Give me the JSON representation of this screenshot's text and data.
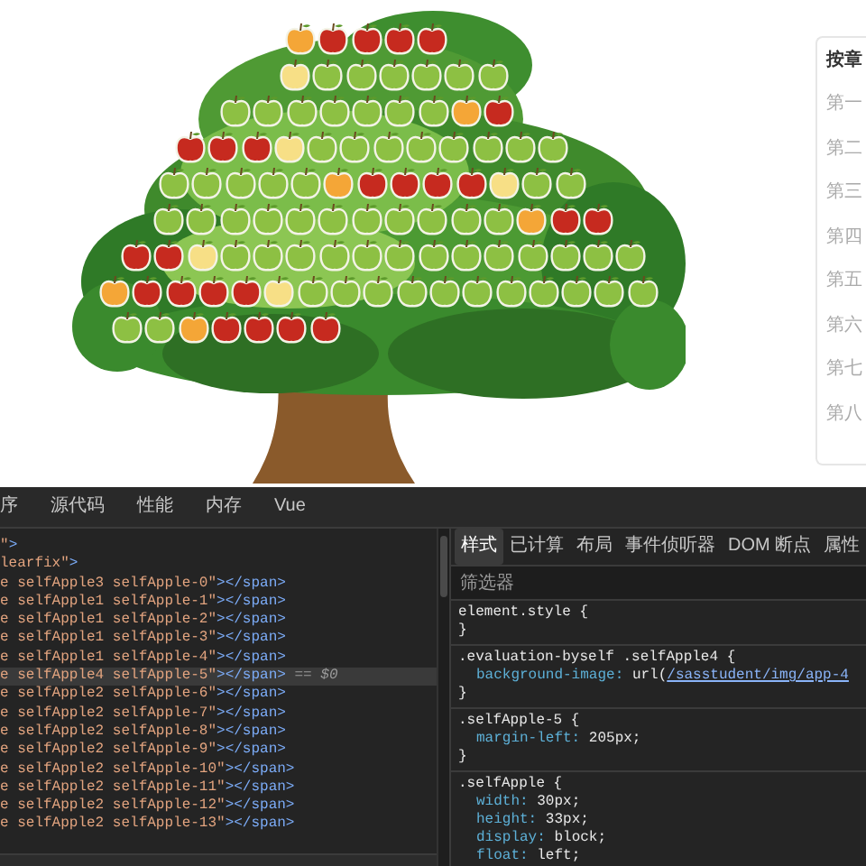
{
  "apple_tree": {
    "rows": [
      [
        {
          "color": "#f4a637"
        },
        {
          "color": "#c62a1f"
        },
        {
          "color": "#c62a1f"
        },
        {
          "color": "#c62a1f"
        },
        {
          "color": "#c62a1f"
        }
      ],
      [
        {
          "color": "#f7df86"
        },
        {
          "color": "#8dc043"
        },
        {
          "color": "#8dc043"
        },
        {
          "color": "#8dc043"
        },
        {
          "color": "#8dc043"
        },
        {
          "color": "#8dc043"
        },
        {
          "color": "#8dc043"
        }
      ],
      [
        {
          "color": "#8dc043"
        },
        {
          "color": "#8dc043"
        },
        {
          "color": "#8dc043"
        },
        {
          "color": "#8dc043"
        },
        {
          "color": "#8dc043"
        },
        {
          "color": "#8dc043"
        },
        {
          "color": "#8dc043"
        },
        {
          "color": "#f4a637"
        },
        {
          "color": "#c62a1f"
        }
      ],
      [
        {
          "color": "#c62a1f"
        },
        {
          "color": "#c62a1f"
        },
        {
          "color": "#c62a1f"
        },
        {
          "color": "#f7df86"
        },
        {
          "color": "#8dc043"
        },
        {
          "color": "#8dc043"
        },
        {
          "color": "#8dc043"
        },
        {
          "color": "#8dc043"
        },
        {
          "color": "#8dc043"
        },
        {
          "color": "#8dc043"
        },
        {
          "color": "#8dc043"
        },
        {
          "color": "#8dc043"
        }
      ],
      [
        {
          "color": "#8dc043"
        },
        {
          "color": "#8dc043"
        },
        {
          "color": "#8dc043"
        },
        {
          "color": "#8dc043"
        },
        {
          "color": "#8dc043"
        },
        {
          "color": "#f4a637"
        },
        {
          "color": "#c62a1f"
        },
        {
          "color": "#c62a1f"
        },
        {
          "color": "#c62a1f"
        },
        {
          "color": "#c62a1f"
        },
        {
          "color": "#f7df86"
        },
        {
          "color": "#8dc043"
        },
        {
          "color": "#8dc043"
        }
      ],
      [
        {
          "color": "#8dc043"
        },
        {
          "color": "#8dc043"
        },
        {
          "color": "#8dc043"
        },
        {
          "color": "#8dc043"
        },
        {
          "color": "#8dc043"
        },
        {
          "color": "#8dc043"
        },
        {
          "color": "#8dc043"
        },
        {
          "color": "#8dc043"
        },
        {
          "color": "#8dc043"
        },
        {
          "color": "#8dc043"
        },
        {
          "color": "#8dc043"
        },
        {
          "color": "#f4a637"
        },
        {
          "color": "#c62a1f"
        },
        {
          "color": "#c62a1f"
        }
      ],
      [
        {
          "color": "#c62a1f"
        },
        {
          "color": "#c62a1f"
        },
        {
          "color": "#f7df86"
        },
        {
          "color": "#8dc043"
        },
        {
          "color": "#8dc043"
        },
        {
          "color": "#8dc043"
        },
        {
          "color": "#8dc043"
        },
        {
          "color": "#8dc043"
        },
        {
          "color": "#8dc043"
        },
        {
          "color": "#8dc043"
        },
        {
          "color": "#8dc043"
        },
        {
          "color": "#8dc043"
        },
        {
          "color": "#8dc043"
        },
        {
          "color": "#8dc043"
        },
        {
          "color": "#8dc043"
        },
        {
          "color": "#8dc043"
        }
      ],
      [
        {
          "color": "#f4a637"
        },
        {
          "color": "#c62a1f"
        },
        {
          "color": "#c62a1f"
        },
        {
          "color": "#c62a1f"
        },
        {
          "color": "#c62a1f"
        },
        {
          "color": "#f7df86"
        },
        {
          "color": "#8dc043"
        },
        {
          "color": "#8dc043"
        },
        {
          "color": "#8dc043"
        },
        {
          "color": "#8dc043"
        },
        {
          "color": "#8dc043"
        },
        {
          "color": "#8dc043"
        },
        {
          "color": "#8dc043"
        },
        {
          "color": "#8dc043"
        },
        {
          "color": "#8dc043"
        },
        {
          "color": "#8dc043"
        },
        {
          "color": "#8dc043"
        }
      ],
      [
        {
          "color": "#8dc043"
        },
        {
          "color": "#8dc043"
        },
        {
          "color": "#f4a637"
        },
        {
          "color": "#c62a1f"
        },
        {
          "color": "#c62a1f"
        },
        {
          "color": "#c62a1f"
        },
        {
          "color": "#c62a1f"
        }
      ]
    ]
  },
  "chapter_card": {
    "title": "按章",
    "items": [
      "第一",
      "第二",
      "第三",
      "第四",
      "第五",
      "第六",
      "第七",
      "第八"
    ]
  },
  "devtools": {
    "tabs": [
      {
        "label": "序",
        "selected": false
      },
      {
        "label": "源代码",
        "selected": false
      },
      {
        "label": "性能",
        "selected": false
      },
      {
        "label": "内存",
        "selected": false
      },
      {
        "label": "Vue",
        "selected": false
      }
    ],
    "elements": [
      {
        "value": "\"",
        "tag": ">",
        "selected": false
      },
      {
        "value": "learfix\"",
        "tag": ">",
        "selected": false
      },
      {
        "value": "e selfApple3 selfApple-0\"",
        "tag": "></span>",
        "selected": false
      },
      {
        "value": "e selfApple1 selfApple-1\"",
        "tag": "></span>",
        "selected": false
      },
      {
        "value": "e selfApple1 selfApple-2\"",
        "tag": "></span>",
        "selected": false
      },
      {
        "value": "e selfApple1 selfApple-3\"",
        "tag": "></span>",
        "selected": false
      },
      {
        "value": "e selfApple1 selfApple-4\"",
        "tag": "></span>",
        "selected": false
      },
      {
        "value": "e selfApple4 selfApple-5\"",
        "tag": "></span>",
        "selected": true,
        "note": "== $0"
      },
      {
        "value": "e selfApple2 selfApple-6\"",
        "tag": "></span>",
        "selected": false
      },
      {
        "value": "e selfApple2 selfApple-7\"",
        "tag": "></span>",
        "selected": false
      },
      {
        "value": "e selfApple2 selfApple-8\"",
        "tag": "></span>",
        "selected": false
      },
      {
        "value": "e selfApple2 selfApple-9\"",
        "tag": "></span>",
        "selected": false
      },
      {
        "value": "e selfApple2 selfApple-10\"",
        "tag": "></span>",
        "selected": false
      },
      {
        "value": "e selfApple2 selfApple-11\"",
        "tag": "></span>",
        "selected": false
      },
      {
        "value": "e selfApple2 selfApple-12\"",
        "tag": "></span>",
        "selected": false
      },
      {
        "value": "e selfApple2 selfApple-13\"",
        "tag": "></span>",
        "selected": false
      }
    ],
    "styles_tabs": [
      {
        "label": "样式",
        "selected": true
      },
      {
        "label": "已计算",
        "selected": false
      },
      {
        "label": "布局",
        "selected": false
      },
      {
        "label": "事件侦听器",
        "selected": false
      },
      {
        "label": "DOM 断点",
        "selected": false
      },
      {
        "label": "属性",
        "selected": false
      }
    ],
    "filter": {
      "placeholder": "筛选器"
    },
    "rules": [
      {
        "selector": "element.style {",
        "close": "}"
      },
      {
        "selector": ".evaluation-byself .selfApple4 {",
        "declarations": [
          {
            "property": "background-image:",
            "value": "url(",
            "link": "/sasstudent/img/app-4"
          }
        ],
        "close": "}"
      },
      {
        "selector": ".selfApple-5 {",
        "declarations": [
          {
            "property": "margin-left:",
            "value": "205px;"
          }
        ],
        "close": "}"
      },
      {
        "selector": ".selfApple {",
        "declarations": [
          {
            "property": "width:",
            "value": "30px;"
          },
          {
            "property": "height:",
            "value": "33px;"
          },
          {
            "property": "display:",
            "value": "block;"
          },
          {
            "property": "float:",
            "value": "left;"
          }
        ]
      }
    ]
  }
}
